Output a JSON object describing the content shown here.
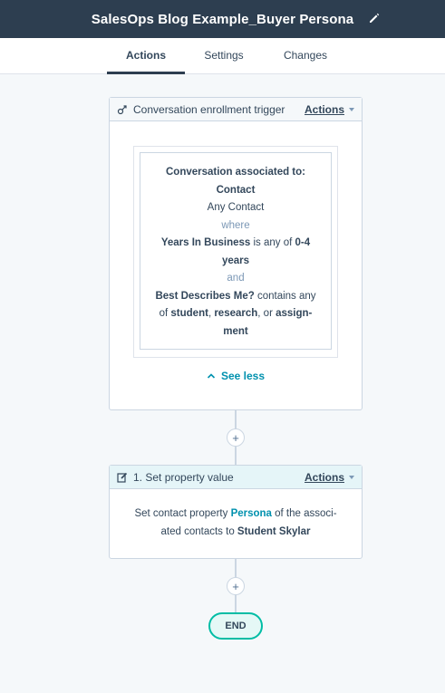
{
  "header": {
    "title": "SalesOps Blog Example_Buyer Persona"
  },
  "tabs": [
    {
      "label": "Actions",
      "active": true
    },
    {
      "label": "Settings",
      "active": false
    },
    {
      "label": "Changes",
      "active": false
    }
  ],
  "trigger": {
    "title": "Conversation enrollment trigger",
    "actions_label": "Actions",
    "filter": {
      "line1": "Conversation associated to:",
      "line2": "Contact",
      "line3": "Any Contact",
      "where": "where",
      "cond1_prop": "Years In Business",
      "cond1_op": " is any of ",
      "cond1_val_a": "0-4",
      "cond1_val_b": "years",
      "and": "and",
      "cond2_prop": "Best Describes Me?",
      "cond2_op_a": " contains any",
      "cond2_op_b": "of ",
      "cond2_v1": "student",
      "cond2_sep1": ", ",
      "cond2_v2": "research",
      "cond2_sep2": ", or ",
      "cond2_v3a": "assign-",
      "cond2_v3b": "ment"
    },
    "see_less": "See less"
  },
  "action1": {
    "title": "1. Set property value",
    "actions_label": "Actions",
    "text_a": "Set contact property ",
    "property": "Persona",
    "text_b": " of the associ-",
    "text_c": "ated contacts to ",
    "value": "Student Skylar"
  },
  "plus_symbol": "+",
  "end_label": "END",
  "colors": {
    "topbar": "#2d3e50",
    "accent": "#0091ae",
    "end_border": "#00bda5",
    "background": "#f5f8fa"
  }
}
